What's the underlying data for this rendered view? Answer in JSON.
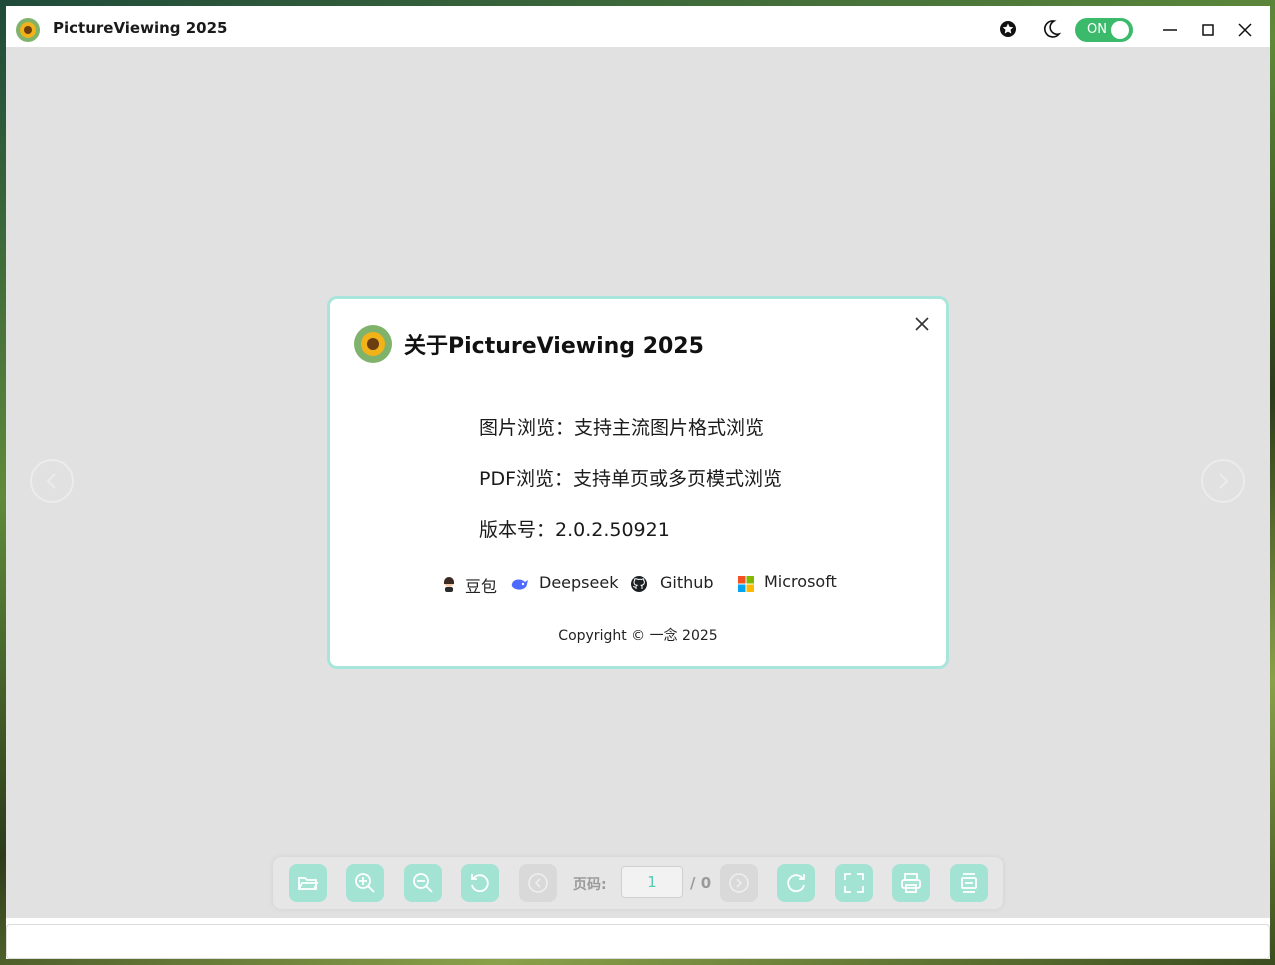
{
  "window": {
    "title": "PictureViewing 2025"
  },
  "titlebar": {
    "theme_toggle": {
      "label": "ON",
      "state": "on",
      "color": "#3cba6b"
    },
    "icons": [
      "star-badge-icon",
      "moon-icon",
      "minimize-icon",
      "maximize-icon",
      "close-icon"
    ]
  },
  "about": {
    "title": "关于PictureViewing 2025",
    "lines": [
      "图片浏览：支持主流图片格式浏览",
      "PDF浏览：支持单页或多页模式浏览",
      "版本号：2.0.2.50921"
    ],
    "links": [
      {
        "label": "豆包",
        "icon": "doubao-avatar-icon"
      },
      {
        "label": "Deepseek",
        "icon": "deepseek-whale-icon"
      },
      {
        "label": "Github",
        "icon": "github-icon"
      },
      {
        "label": "Microsoft",
        "icon": "microsoft-logo-icon"
      }
    ],
    "copyright": "Copyright © 一念 2025"
  },
  "toolbar": {
    "page_label": "页码:",
    "page_value": "1",
    "page_total": "/ 0",
    "accent": "#a3e3d4"
  },
  "colors": {
    "accent": "#a8e6dc",
    "toggle_on": "#3cba6b",
    "canvas": "#e1e1e1"
  }
}
